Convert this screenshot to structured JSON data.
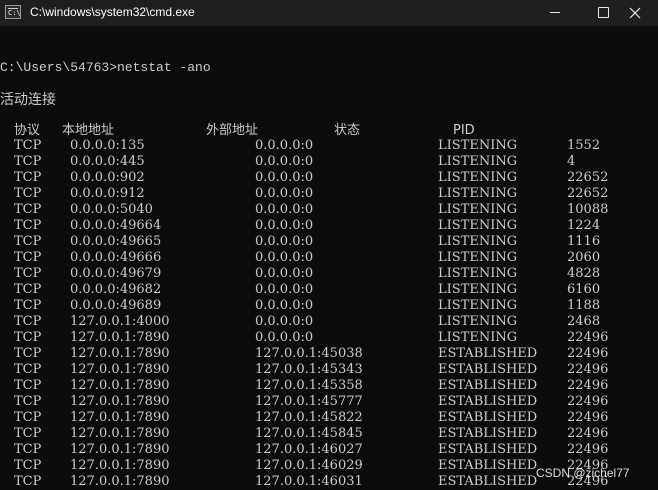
{
  "window": {
    "title": "C:\\windows\\system32\\cmd.exe",
    "icon": "cmd-icon",
    "icon_text": "C:\\",
    "controls": [
      "minimize-icon",
      "maximize-icon",
      "close-icon"
    ]
  },
  "terminal": {
    "command_line": "C:\\Users\\54763>netstat -ano",
    "section_title": "活动连接",
    "headers": {
      "proto": "协议",
      "local": "本地地址",
      "foreign": "外部地址",
      "state": "状态",
      "pid": "PID"
    },
    "rows": [
      {
        "proto": "TCP",
        "local": "0.0.0.0:135",
        "foreign": "0.0.0.0:0",
        "state": "LISTENING",
        "pid": "1552"
      },
      {
        "proto": "TCP",
        "local": "0.0.0.0:445",
        "foreign": "0.0.0.0:0",
        "state": "LISTENING",
        "pid": "4"
      },
      {
        "proto": "TCP",
        "local": "0.0.0.0:902",
        "foreign": "0.0.0.0:0",
        "state": "LISTENING",
        "pid": "22652"
      },
      {
        "proto": "TCP",
        "local": "0.0.0.0:912",
        "foreign": "0.0.0.0:0",
        "state": "LISTENING",
        "pid": "22652"
      },
      {
        "proto": "TCP",
        "local": "0.0.0.0:5040",
        "foreign": "0.0.0.0:0",
        "state": "LISTENING",
        "pid": "10088"
      },
      {
        "proto": "TCP",
        "local": "0.0.0.0:49664",
        "foreign": "0.0.0.0:0",
        "state": "LISTENING",
        "pid": "1224"
      },
      {
        "proto": "TCP",
        "local": "0.0.0.0:49665",
        "foreign": "0.0.0.0:0",
        "state": "LISTENING",
        "pid": "1116"
      },
      {
        "proto": "TCP",
        "local": "0.0.0.0:49666",
        "foreign": "0.0.0.0:0",
        "state": "LISTENING",
        "pid": "2060"
      },
      {
        "proto": "TCP",
        "local": "0.0.0.0:49679",
        "foreign": "0.0.0.0:0",
        "state": "LISTENING",
        "pid": "4828"
      },
      {
        "proto": "TCP",
        "local": "0.0.0.0:49682",
        "foreign": "0.0.0.0:0",
        "state": "LISTENING",
        "pid": "6160"
      },
      {
        "proto": "TCP",
        "local": "0.0.0.0:49689",
        "foreign": "0.0.0.0:0",
        "state": "LISTENING",
        "pid": "1188"
      },
      {
        "proto": "TCP",
        "local": "127.0.0.1:4000",
        "foreign": "0.0.0.0:0",
        "state": "LISTENING",
        "pid": "2468"
      },
      {
        "proto": "TCP",
        "local": "127.0.0.1:7890",
        "foreign": "0.0.0.0:0",
        "state": "LISTENING",
        "pid": "22496"
      },
      {
        "proto": "TCP",
        "local": "127.0.0.1:7890",
        "foreign": "127.0.0.1:45038",
        "state": "ESTABLISHED",
        "pid": "22496"
      },
      {
        "proto": "TCP",
        "local": "127.0.0.1:7890",
        "foreign": "127.0.0.1:45343",
        "state": "ESTABLISHED",
        "pid": "22496"
      },
      {
        "proto": "TCP",
        "local": "127.0.0.1:7890",
        "foreign": "127.0.0.1:45358",
        "state": "ESTABLISHED",
        "pid": "22496"
      },
      {
        "proto": "TCP",
        "local": "127.0.0.1:7890",
        "foreign": "127.0.0.1:45777",
        "state": "ESTABLISHED",
        "pid": "22496"
      },
      {
        "proto": "TCP",
        "local": "127.0.0.1:7890",
        "foreign": "127.0.0.1:45822",
        "state": "ESTABLISHED",
        "pid": "22496"
      },
      {
        "proto": "TCP",
        "local": "127.0.0.1:7890",
        "foreign": "127.0.0.1:45845",
        "state": "ESTABLISHED",
        "pid": "22496"
      },
      {
        "proto": "TCP",
        "local": "127.0.0.1:7890",
        "foreign": "127.0.0.1:46027",
        "state": "ESTABLISHED",
        "pid": "22496"
      },
      {
        "proto": "TCP",
        "local": "127.0.0.1:7890",
        "foreign": "127.0.0.1:46029",
        "state": "ESTABLISHED",
        "pid": "22496"
      },
      {
        "proto": "TCP",
        "local": "127.0.0.1:7890",
        "foreign": "127.0.0.1:46031",
        "state": "ESTABLISHED",
        "pid": "22496"
      }
    ]
  },
  "watermark": "CSDN @zichel77",
  "colors": {
    "background": "#0c0c0c",
    "titlebar": "#1f1f1f",
    "text": "#cccccc"
  }
}
